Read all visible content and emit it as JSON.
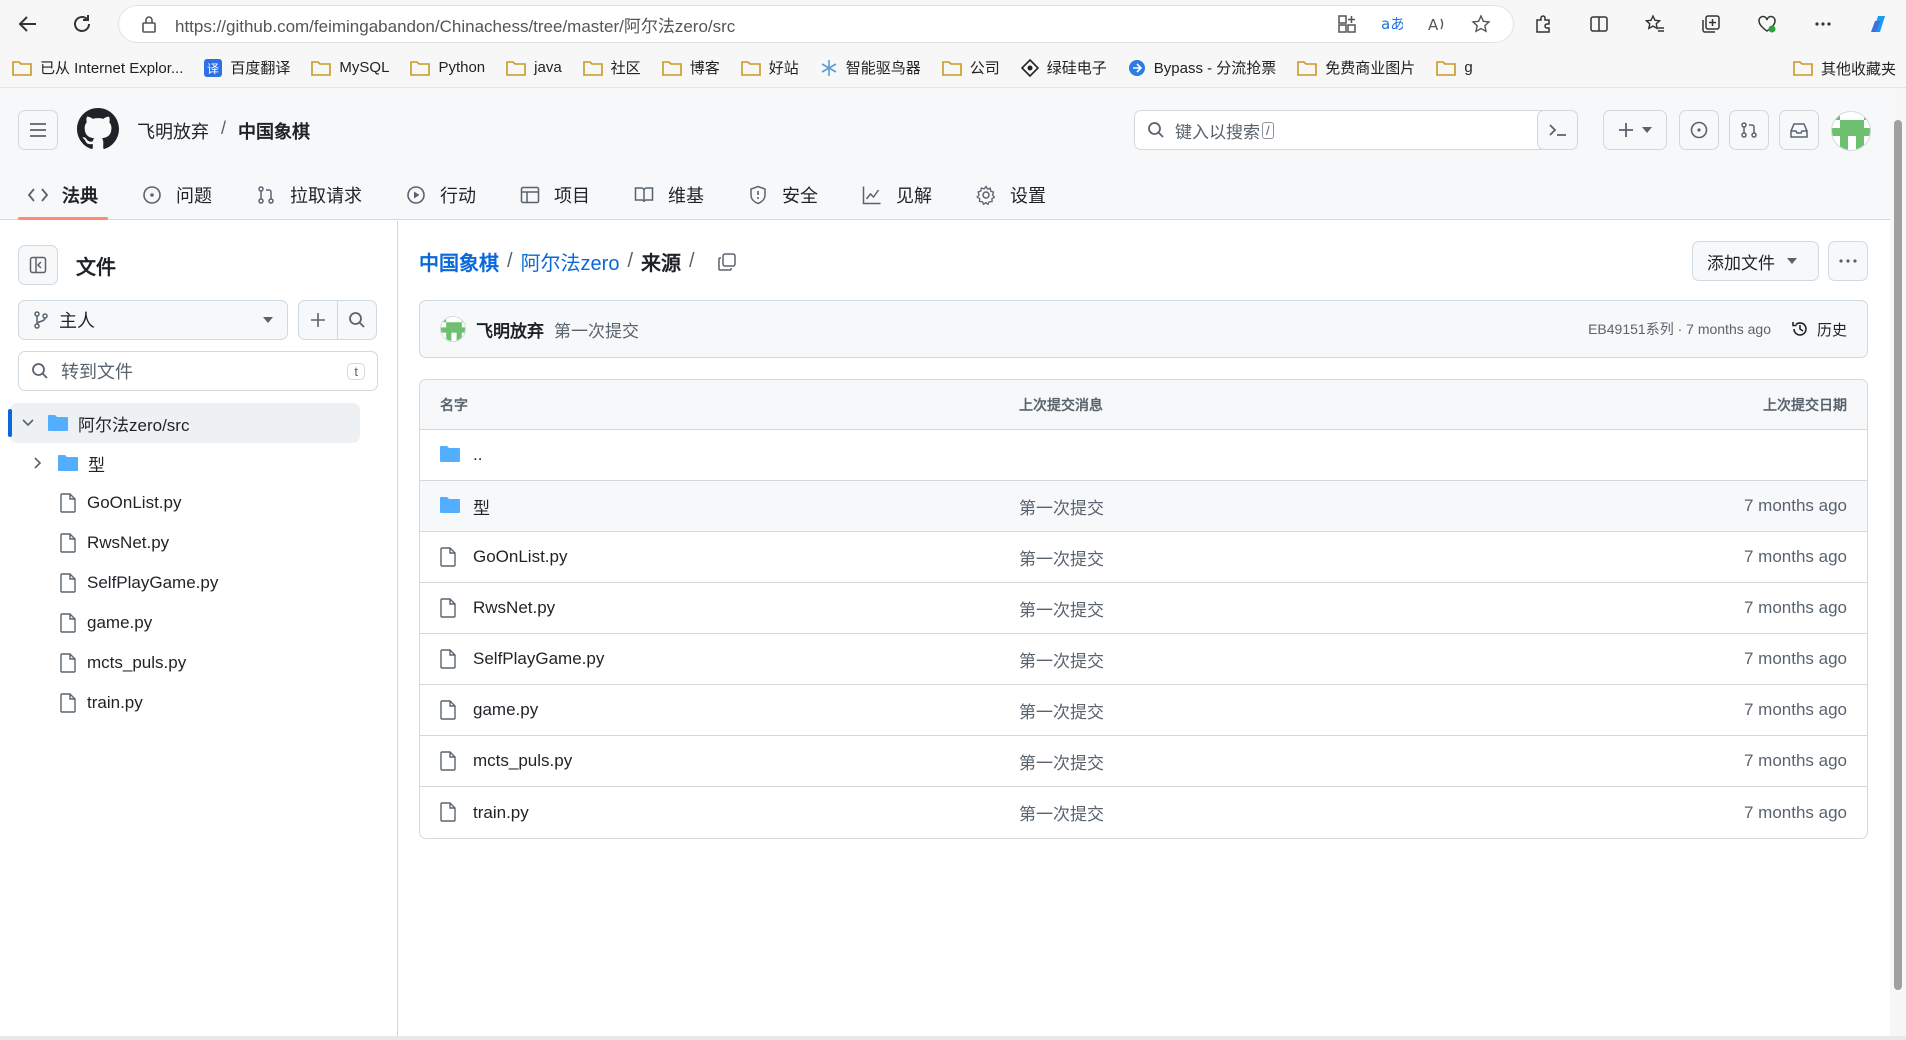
{
  "browser": {
    "url": "https://github.com/feimingabandon/Chinachess/tree/master/阿尔法zero/src",
    "bookmarks": [
      {
        "label": "已从 Internet Explor...",
        "icon": "folder-icon"
      },
      {
        "label": "百度翻译",
        "icon": "translate-icon"
      },
      {
        "label": "MySQL",
        "icon": "folder-icon"
      },
      {
        "label": "Python",
        "icon": "folder-icon"
      },
      {
        "label": "java",
        "icon": "folder-icon"
      },
      {
        "label": "社区",
        "icon": "folder-icon"
      },
      {
        "label": "博客",
        "icon": "folder-icon"
      },
      {
        "label": "好站",
        "icon": "folder-icon"
      },
      {
        "label": "智能驱鸟器",
        "icon": "snowflake-icon"
      },
      {
        "label": "公司",
        "icon": "folder-icon"
      },
      {
        "label": "绿硅电子",
        "icon": "diamond-icon"
      },
      {
        "label": "Bypass - 分流抢票",
        "icon": "bypass-icon"
      },
      {
        "label": "免费商业图片",
        "icon": "folder-icon"
      },
      {
        "label": "g",
        "icon": "folder-icon"
      }
    ],
    "other_bookmarks": "其他收藏夹"
  },
  "header": {
    "owner": "飞明放弃",
    "separator": "/",
    "repo": "中国象棋",
    "search_placeholder": "键入以搜索",
    "search_kbd": "/",
    "tabs": [
      {
        "label": "法典",
        "icon": "code-icon"
      },
      {
        "label": "问题",
        "icon": "issue-icon"
      },
      {
        "label": "拉取请求",
        "icon": "pull-request-icon"
      },
      {
        "label": "行动",
        "icon": "play-icon"
      },
      {
        "label": "项目",
        "icon": "table-icon"
      },
      {
        "label": "维基",
        "icon": "book-icon"
      },
      {
        "label": "安全",
        "icon": "shield-icon"
      },
      {
        "label": "见解",
        "icon": "graph-icon"
      },
      {
        "label": "设置",
        "icon": "gear-icon"
      }
    ]
  },
  "sidebar": {
    "title": "文件",
    "branch": "主人",
    "goto_placeholder": "转到文件",
    "goto_kbd": "t",
    "tree": [
      {
        "label": "阿尔法zero/src",
        "type": "folder-open",
        "level": 0
      },
      {
        "label": "型",
        "type": "folder",
        "level": 1
      },
      {
        "label": "GoOnList.py",
        "type": "file",
        "level": 1
      },
      {
        "label": "RwsNet.py",
        "type": "file",
        "level": 1
      },
      {
        "label": "SelfPlayGame.py",
        "type": "file",
        "level": 1
      },
      {
        "label": "game.py",
        "type": "file",
        "level": 1
      },
      {
        "label": "mcts_puls.py",
        "type": "file",
        "level": 1
      },
      {
        "label": "train.py",
        "type": "file",
        "level": 1
      }
    ]
  },
  "main": {
    "path": {
      "repo": "中国象棋",
      "dir": "阿尔法zero",
      "current": "来源",
      "sep": "/"
    },
    "add_file_label": "添加文件",
    "commit": {
      "author": "飞明放弃",
      "message": "第一次提交",
      "meta": "EB49151系列 · 7 months ago",
      "history_label": "历史"
    },
    "table": {
      "headers": {
        "name": "名字",
        "message": "上次提交消息",
        "date": "上次提交日期"
      },
      "parent_label": "..",
      "rows": [
        {
          "name": "型",
          "type": "folder",
          "message": "第一次提交",
          "date": "7 months ago"
        },
        {
          "name": "GoOnList.py",
          "type": "file",
          "message": "第一次提交",
          "date": "7 months ago"
        },
        {
          "name": "RwsNet.py",
          "type": "file",
          "message": "第一次提交",
          "date": "7 months ago"
        },
        {
          "name": "SelfPlayGame.py",
          "type": "file",
          "message": "第一次提交",
          "date": "7 months ago"
        },
        {
          "name": "game.py",
          "type": "file",
          "message": "第一次提交",
          "date": "7 months ago"
        },
        {
          "name": "mcts_puls.py",
          "type": "file",
          "message": "第一次提交",
          "date": "7 months ago"
        },
        {
          "name": "train.py",
          "type": "file",
          "message": "第一次提交",
          "date": "7 months ago"
        }
      ]
    }
  },
  "colors": {
    "link": "#0969da",
    "folder": "#54aeff",
    "tab_underline": "#fd8c73",
    "muted": "#59636e",
    "border": "#d1d9e0"
  }
}
